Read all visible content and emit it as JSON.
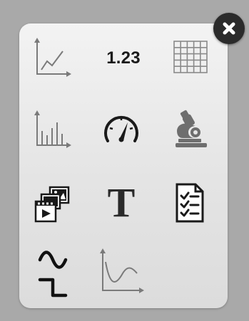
{
  "widget_palette": {
    "tiles": [
      {
        "icon": "line-chart-icon"
      },
      {
        "icon": "number-display-icon",
        "label": "1.23"
      },
      {
        "icon": "table-grid-icon"
      },
      {
        "icon": "bar-chart-icon"
      },
      {
        "icon": "gauge-icon"
      },
      {
        "icon": "microscope-icon"
      },
      {
        "icon": "media-gallery-icon"
      },
      {
        "icon": "text-icon",
        "label": "T"
      },
      {
        "icon": "checklist-document-icon"
      },
      {
        "icon": "signal-waveform-icon"
      },
      {
        "icon": "curve-plot-icon"
      }
    ]
  },
  "close_button": {
    "icon": "close-icon"
  },
  "colors": {
    "backdrop": "#a9a9a9",
    "panel": "#e8e8e8",
    "icon_light": "#7a7a7a",
    "icon_dark": "#1a1a1a"
  }
}
